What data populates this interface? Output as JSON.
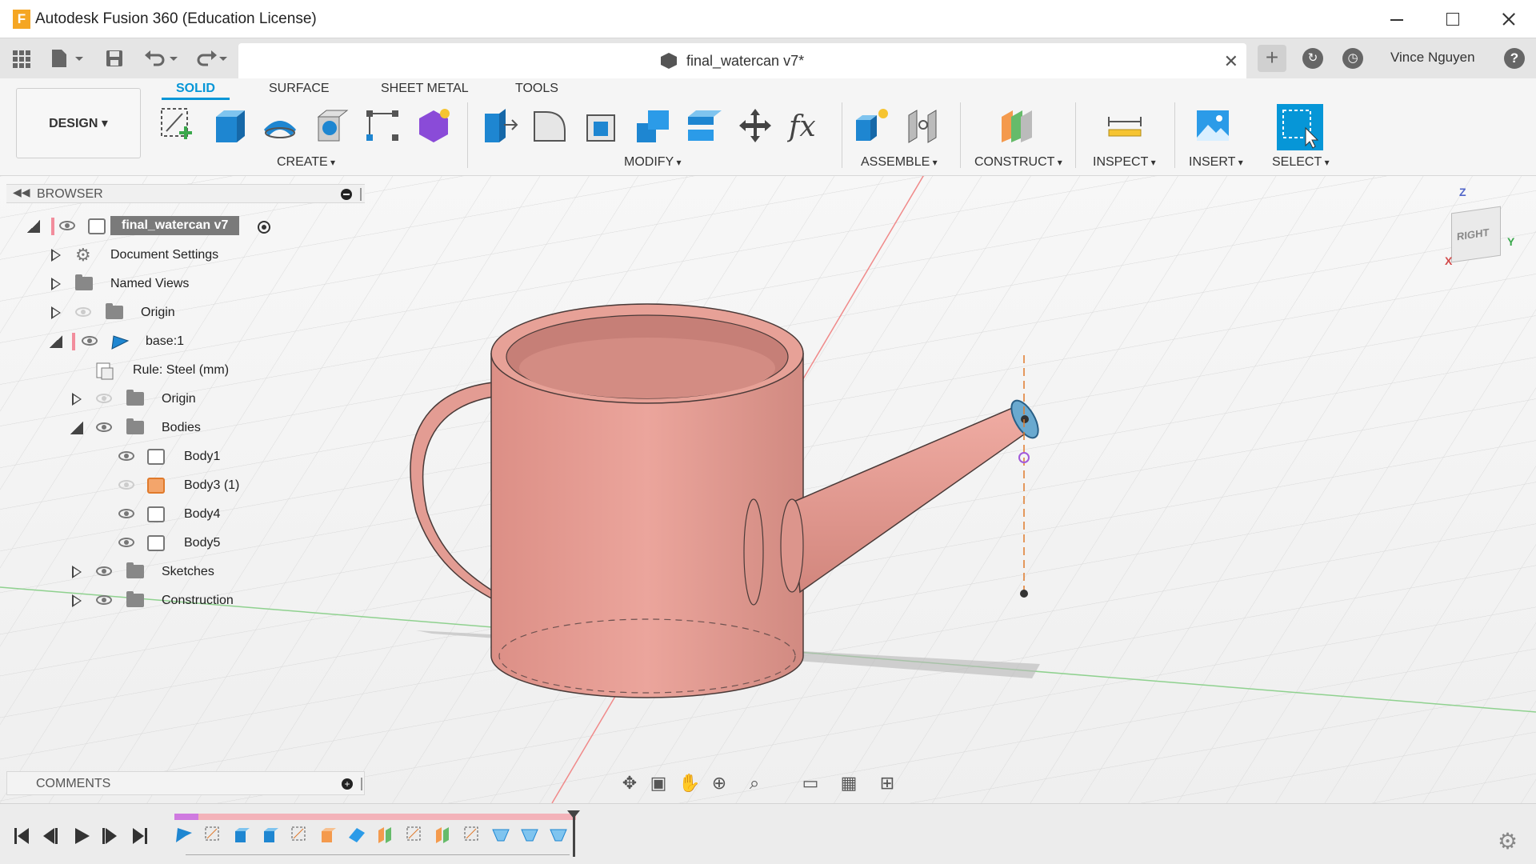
{
  "window": {
    "title": "Autodesk Fusion 360 (Education License)",
    "logo_letter": "F"
  },
  "quickbar": {
    "document_tab_title": "final_watercan v7*",
    "user_name": "Vince Nguyen",
    "help": "?"
  },
  "ribbon": {
    "workspace": "DESIGN",
    "tabs": [
      "SOLID",
      "SURFACE",
      "SHEET METAL",
      "TOOLS"
    ],
    "active_tab": "SOLID",
    "groups": [
      "CREATE",
      "MODIFY",
      "ASSEMBLE",
      "CONSTRUCT",
      "INSPECT",
      "INSERT",
      "SELECT"
    ]
  },
  "browser": {
    "title": "BROWSER",
    "items": [
      {
        "label": "final_watercan v7",
        "icon": "component-icon"
      },
      {
        "label": "Document Settings",
        "icon": "gear-icon"
      },
      {
        "label": "Named Views",
        "icon": "folder-icon"
      },
      {
        "label": "Origin",
        "icon": "folder-icon"
      },
      {
        "label": "base:1",
        "icon": "component-link-icon"
      },
      {
        "label": "Rule: Steel (mm)",
        "icon": "rule-icon"
      },
      {
        "label": "Origin",
        "icon": "folder-icon"
      },
      {
        "label": "Bodies",
        "icon": "folder-icon"
      },
      {
        "label": "Body1",
        "icon": "body-icon"
      },
      {
        "label": "Body3 (1)",
        "icon": "body-icon"
      },
      {
        "label": "Body4",
        "icon": "body-icon"
      },
      {
        "label": "Body5",
        "icon": "body-icon"
      },
      {
        "label": "Sketches",
        "icon": "folder-icon"
      },
      {
        "label": "Construction",
        "icon": "folder-icon"
      }
    ]
  },
  "comments": {
    "title": "COMMENTS"
  },
  "viewcube": {
    "face": "RIGHT",
    "axis_z": "Z",
    "axis_x": "X",
    "axis_y": "Y"
  },
  "colors": {
    "accent": "#0696d7",
    "body": "#e8a097",
    "timeline_track": "#f3b2b9"
  }
}
